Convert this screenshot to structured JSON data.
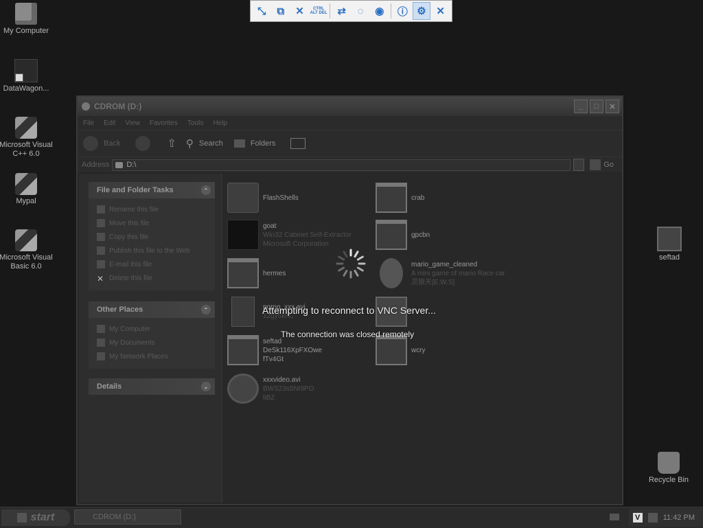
{
  "desktop": {
    "icons": [
      {
        "label": "My Computer"
      },
      {
        "label": "DataWagon..."
      },
      {
        "label": "Microsoft Visual C++ 6.0"
      },
      {
        "label": "Mypal"
      },
      {
        "label": "Microsoft Visual Basic 6.0"
      },
      {
        "label": "seftad"
      },
      {
        "label": "Recycle Bin"
      }
    ]
  },
  "vnc_toolbar": {
    "buttons": [
      "minimize-icon",
      "scale-icon",
      "mute-icon",
      "ctrl-alt-del",
      "transfer-icon",
      "chat-icon",
      "record-icon",
      "info-icon",
      "settings-icon",
      "close-icon"
    ],
    "cad_label": "CTRL ALT DEL"
  },
  "window": {
    "title": "CDROM (D:)",
    "menu": [
      "File",
      "Edit",
      "View",
      "Favorites",
      "Tools",
      "Help"
    ],
    "toolbar": {
      "back": "Back",
      "search": "Search",
      "folders": "Folders"
    },
    "address": {
      "label": "Address",
      "value": "D:\\",
      "go": "Go"
    },
    "file_tasks": {
      "title": "File and Folder Tasks",
      "items": [
        "Rename this file",
        "Move this file",
        "Copy this file",
        "Publish this file to the Web",
        "E-mail this file",
        "Delete this file"
      ]
    },
    "other_places": {
      "title": "Other Places",
      "items": [
        "My Computer",
        "My Documents",
        "My Network Places"
      ]
    },
    "details": {
      "title": "Details"
    },
    "files": [
      {
        "name": "FlashShells",
        "sub1": "",
        "sub2": "",
        "icon": "folder"
      },
      {
        "name": "crab",
        "sub1": "",
        "sub2": "",
        "icon": "window"
      },
      {
        "name": "goat",
        "sub1": "Win32 Cabinet Self-Extractor",
        "sub2": "Microsoft Corporation",
        "icon": "cube"
      },
      {
        "name": "gpcbn",
        "sub1": "",
        "sub2": "",
        "icon": "window"
      },
      {
        "name": "hermes",
        "sub1": "",
        "sub2": "",
        "icon": "window"
      },
      {
        "name": "mario_game_cleaned",
        "sub1": "A mini game of mario Race car",
        "sub2": "灵狼天[E.W.S]",
        "icon": "egg"
      },
      {
        "name": "porno_xxx.avi",
        "sub1": "12gy5knC",
        "sub2": "",
        "icon": "avi"
      },
      {
        "name": "",
        "sub1": "",
        "sub2": "",
        "icon": "pc"
      },
      {
        "name": "seftad",
        "sub1": "DeSk116XpFXOwe",
        "sub2": "fTv4Gt",
        "icon": "window"
      },
      {
        "name": "wcry",
        "sub1": "",
        "sub2": "",
        "icon": "window"
      },
      {
        "name": "xxxvideo.avi",
        "sub1": "BWS23s5Nt9PO",
        "sub2": "liBZ",
        "icon": "media"
      }
    ]
  },
  "taskbar": {
    "start": "start",
    "task_button": "CDROM (D:)",
    "tray_v": "V",
    "clock": "11:42 PM"
  },
  "overlay": {
    "message": "Attempting to reconnect to VNC Server...",
    "detail": "The connection was closed remotely"
  }
}
